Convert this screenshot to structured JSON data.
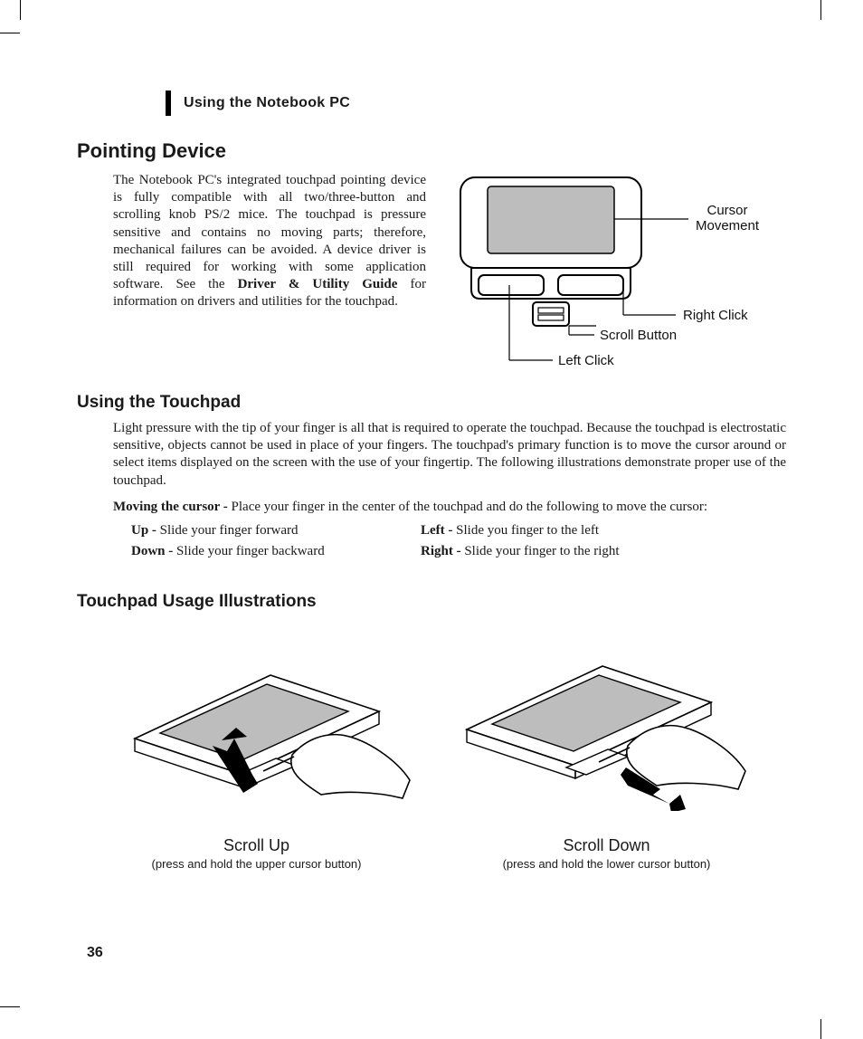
{
  "running_head": "Using the Notebook PC",
  "page_number": "36",
  "h1_pointing": "Pointing Device",
  "p_pointing_1a": "The Notebook PC's integrated touchpad pointing device is fully compatible with all two/three-button and scrolling knob PS/2 mice. The touchpad is pressure sensitive and contains no moving parts; therefore, mechanical failures can be avoided. A device driver is still required for working with some application software. See the ",
  "p_pointing_1b_bold": "Driver & Utility Guide",
  "p_pointing_1c": " for information on drivers and utilities for the touchpad.",
  "labels": {
    "cursor": "Cursor\nMovement",
    "right": "Right Click",
    "scroll": "Scroll Button",
    "left": "Left Click"
  },
  "h2_using": "Using the Touchpad",
  "p_using": "Light pressure with the tip of your finger is all that is required to operate the touchpad. Because the touchpad is electrostatic sensitive, objects cannot be used in place of your fingers. The touchpad's primary function is to move the cursor around or select items displayed on the screen with the use of your fingertip. The following illustrations demonstrate proper use of the touchpad.",
  "p_moving_bold": "Moving the cursor - ",
  "p_moving_rest": "Place your finger in the center of the touchpad and do the following to move the cursor:",
  "dirs": {
    "up_b": "Up - ",
    "up_t": "Slide your finger forward",
    "down_b": "Down - ",
    "down_t": "Slide your finger backward",
    "left_b": "Left - ",
    "left_t": "Slide you finger to the left",
    "right_b": "Right - ",
    "right_t": "Slide your finger to the right"
  },
  "h2_illus": "Touchpad Usage Illustrations",
  "illus": {
    "up_title": "Scroll Up",
    "up_sub": "(press and hold the upper cursor button)",
    "down_title": "Scroll Down",
    "down_sub": "(press and hold the lower cursor button)"
  }
}
